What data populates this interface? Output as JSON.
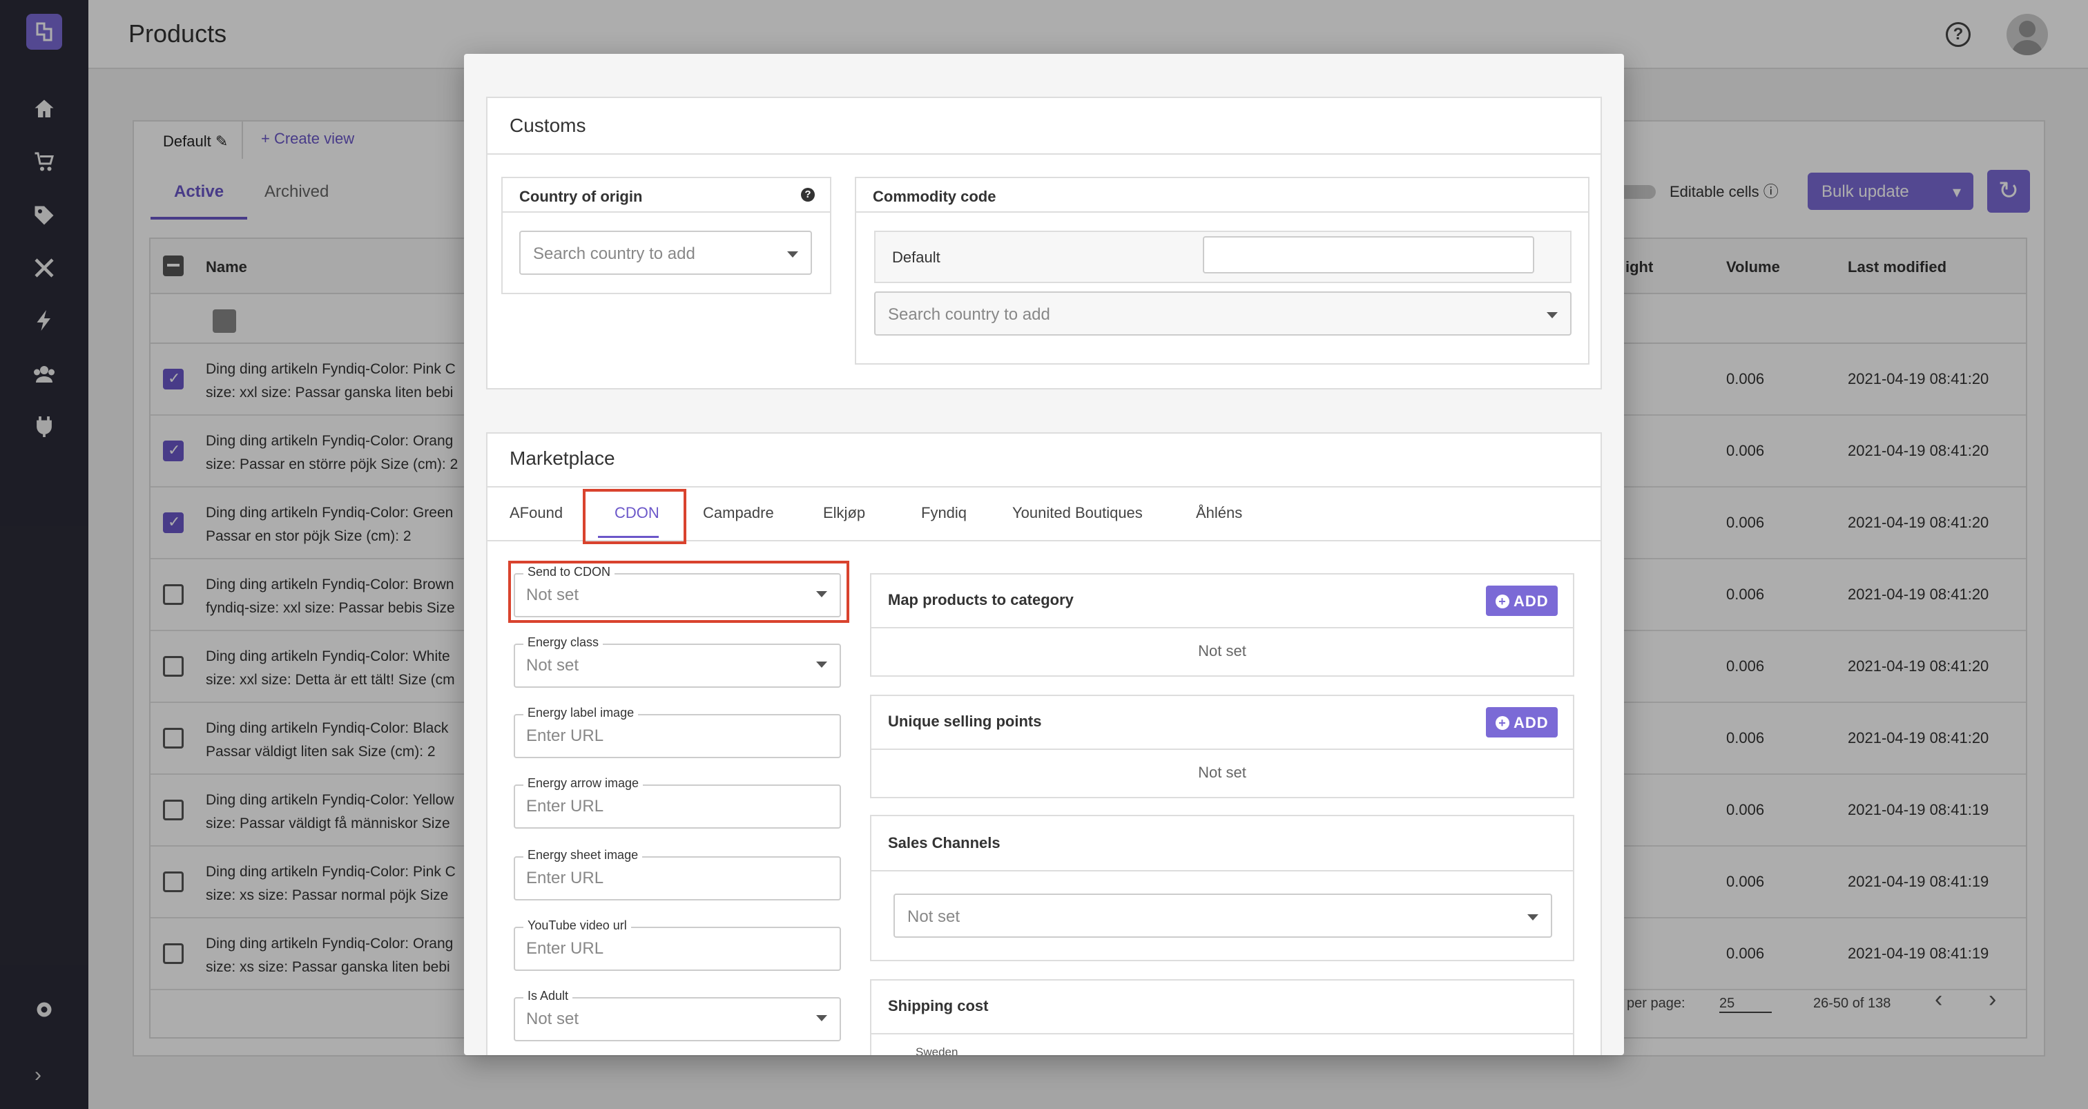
{
  "app": {
    "page_title": "Products",
    "colors": {
      "accent": "#7b6ad6",
      "highlight": "#d9432e",
      "sidebar": "#2c2c38"
    }
  },
  "sidebar": {
    "icons": [
      "logo-icon",
      "home-icon",
      "cart-icon",
      "tag-icon",
      "tools-icon",
      "bolt-icon",
      "users-icon",
      "plug-icon",
      "gear-icon",
      "chevron-right-icon"
    ]
  },
  "views": {
    "default_label": "Default",
    "create_view": "+ Create view",
    "tabs": {
      "active": "Active",
      "archived": "Archived"
    }
  },
  "toolbar": {
    "editable_cells": "Editable cells",
    "bulk_update": "Bulk update"
  },
  "table": {
    "headers": {
      "name": "Name",
      "weight": "ight",
      "volume": "Volume",
      "last_modified": "Last modified"
    },
    "rows": [
      {
        "checked": true,
        "name": "Ding ding artikeln Fyndiq-Color: Pink C\nsize: xxl size: Passar ganska liten bebi",
        "volume": "0.006",
        "modified": "2021-04-19 08:41:20"
      },
      {
        "checked": true,
        "name": "Ding ding artikeln Fyndiq-Color: Orang\nsize: Passar en större pöjk Size (cm): 2",
        "volume": "0.006",
        "modified": "2021-04-19 08:41:20"
      },
      {
        "checked": true,
        "name": "Ding ding artikeln Fyndiq-Color: Green\nPassar en stor pöjk Size (cm): 2",
        "volume": "0.006",
        "modified": "2021-04-19 08:41:20"
      },
      {
        "checked": false,
        "name": "Ding ding artikeln Fyndiq-Color: Brown\nfyndiq-size: xxl size: Passar bebis Size",
        "volume": "0.006",
        "modified": "2021-04-19 08:41:20"
      },
      {
        "checked": false,
        "name": "Ding ding artikeln Fyndiq-Color: White\nsize: xxl size: Detta är ett tält! Size (cm",
        "volume": "0.006",
        "modified": "2021-04-19 08:41:20"
      },
      {
        "checked": false,
        "name": "Ding ding artikeln Fyndiq-Color: Black\nPassar väldigt liten sak Size (cm): 2",
        "volume": "0.006",
        "modified": "2021-04-19 08:41:20"
      },
      {
        "checked": false,
        "name": "Ding ding artikeln Fyndiq-Color: Yellow\nsize: Passar väldigt få människor Size",
        "volume": "0.006",
        "modified": "2021-04-19 08:41:19"
      },
      {
        "checked": false,
        "name": "Ding ding artikeln Fyndiq-Color: Pink C\nsize: xs size: Passar normal pöjk Size",
        "volume": "0.006",
        "modified": "2021-04-19 08:41:19"
      },
      {
        "checked": false,
        "name": "Ding ding artikeln Fyndiq-Color: Orang\nsize: xs size: Passar ganska liten bebi",
        "volume": "0.006",
        "modified": "2021-04-19 08:41:19"
      }
    ],
    "pager": {
      "per_page_label": "per page:",
      "per_page": "25",
      "range": "26-50 of 138"
    }
  },
  "modal": {
    "customs": {
      "title": "Customs",
      "country_of_origin": {
        "title": "Country of origin",
        "placeholder": "Search country to add"
      },
      "commodity_code": {
        "title": "Commodity code",
        "default_label": "Default",
        "default_value": "",
        "placeholder": "Search country to add"
      }
    },
    "marketplace": {
      "title": "Marketplace",
      "tabs": [
        "AFound",
        "CDON",
        "Campadre",
        "Elkjøp",
        "Fyndiq",
        "Younited Boutiques",
        "Åhléns"
      ],
      "active_tab": "CDON",
      "fields": [
        {
          "label": "Send to CDON",
          "value": "Not set",
          "type": "select"
        },
        {
          "label": "Energy class",
          "value": "Not set",
          "type": "select"
        },
        {
          "label": "Energy label image",
          "value": "Enter URL",
          "type": "input"
        },
        {
          "label": "Energy arrow image",
          "value": "Enter URL",
          "type": "input"
        },
        {
          "label": "Energy sheet image",
          "value": "Enter URL",
          "type": "input"
        },
        {
          "label": "YouTube video url",
          "value": "Enter URL",
          "type": "input"
        },
        {
          "label": "Is Adult",
          "value": "Not set",
          "type": "select"
        }
      ],
      "map_category": {
        "title": "Map products to category",
        "button": "ADD",
        "value": "Not set"
      },
      "usp": {
        "title": "Unique selling points",
        "button": "ADD",
        "value": "Not set"
      },
      "sales_channels": {
        "title": "Sales Channels",
        "value": "Not set"
      },
      "shipping_cost": {
        "title": "Shipping cost",
        "partial_label": "Sweden"
      }
    }
  }
}
